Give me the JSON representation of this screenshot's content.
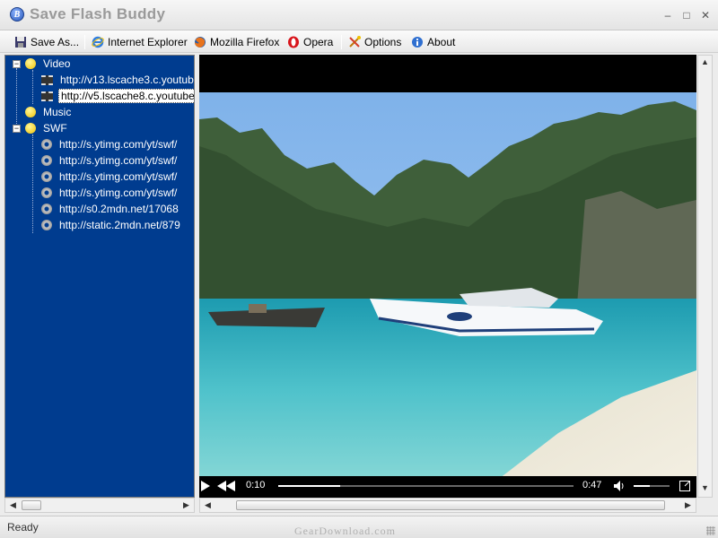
{
  "window": {
    "title": "Save Flash Buddy",
    "logo_letter": "B",
    "controls": {
      "minimize": "–",
      "maximize": "□",
      "close": "✕"
    }
  },
  "toolbar": {
    "items": [
      {
        "label": "Save As...",
        "icon": "floppy-disk-icon"
      },
      {
        "label": "Internet Explorer",
        "icon": "internet-explorer-icon"
      },
      {
        "label": "Mozilla Firefox",
        "icon": "firefox-icon"
      },
      {
        "label": "Opera",
        "icon": "opera-icon"
      },
      {
        "label": "Options",
        "icon": "tools-icon"
      },
      {
        "label": "About",
        "icon": "info-icon"
      }
    ]
  },
  "tree": {
    "video": {
      "label": "Video",
      "children": [
        "http://v13.lscache3.c.youtube",
        "http://v5.lscache8.c.youtube"
      ],
      "selected_index": 1
    },
    "music": {
      "label": "Music"
    },
    "swf": {
      "label": "SWF",
      "children": [
        "http://s.ytimg.com/yt/swf/",
        "http://s.ytimg.com/yt/swf/",
        "http://s.ytimg.com/yt/swf/",
        "http://s.ytimg.com/yt/swf/",
        "http://s0.2mdn.net/17068",
        "http://static.2mdn.net/879"
      ]
    }
  },
  "player": {
    "current_time": "0:10",
    "duration": "0:47",
    "progress_fraction": 0.21,
    "volume_fraction": 0.45
  },
  "status": {
    "text": "Ready",
    "watermark": "GearDownload.com"
  },
  "colors": {
    "tree_background": "#003c8f",
    "player_background": "#000000"
  }
}
